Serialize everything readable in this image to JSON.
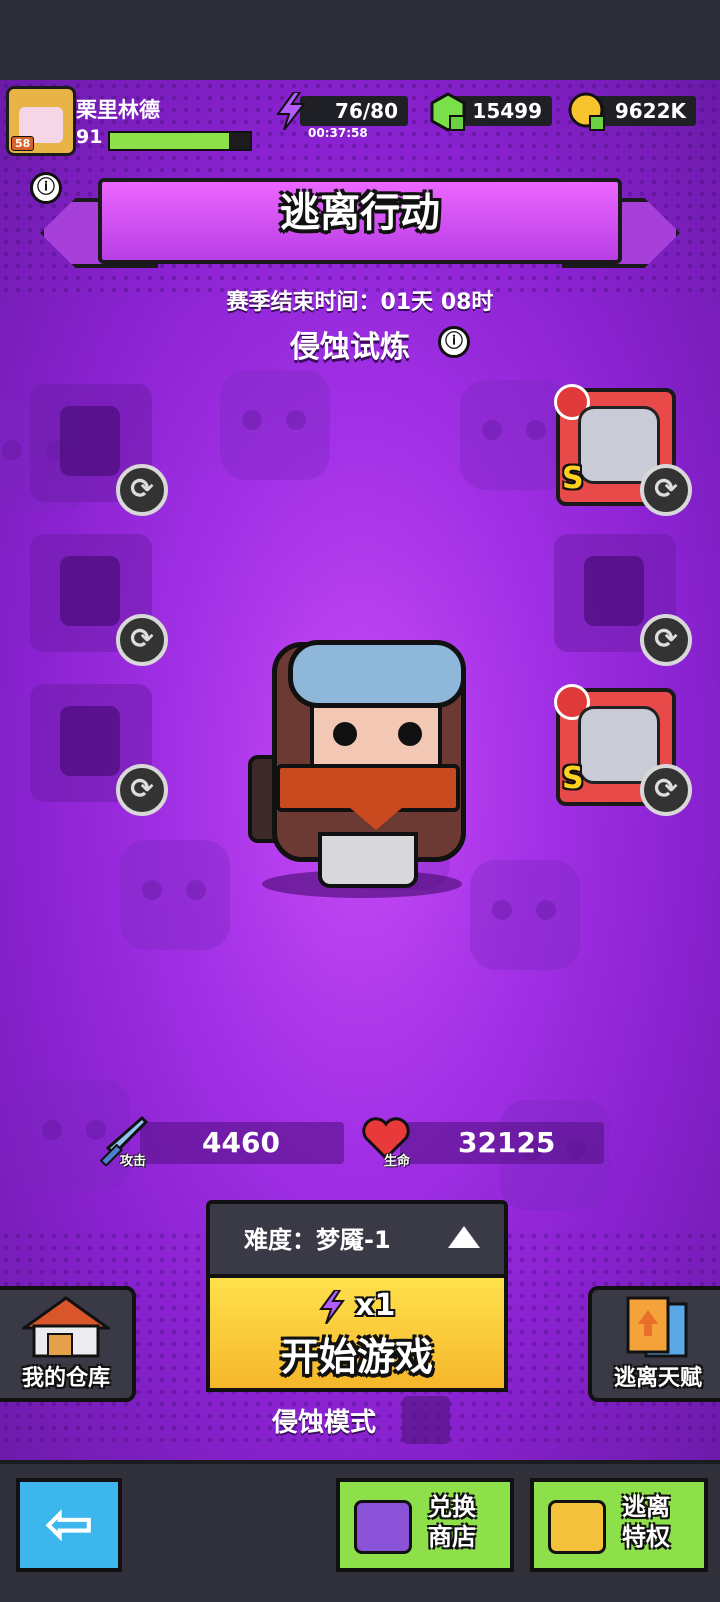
{
  "player": {
    "name": "栗里林德",
    "level": "91",
    "avatar_badge": "58",
    "xp_fraction": 0.85
  },
  "resources": {
    "energy": "76/80",
    "energy_timer": "00:37:58",
    "gems": "15499",
    "gold": "9622K"
  },
  "event": {
    "title": "逃离行动",
    "season_end": "赛季结束时间：01天 08时",
    "mode_title": "侵蚀试炼",
    "info_icon": "ⓘ"
  },
  "equipment": {
    "left_slots": [
      "weapon-slot-empty",
      "necklace-slot-empty",
      "glove-slot-empty"
    ],
    "right_slots": [
      {
        "name": "armor-slot",
        "grade": "S"
      },
      {
        "name": "belt-slot-empty"
      },
      {
        "name": "boots-slot",
        "grade": "S"
      }
    ]
  },
  "stats": {
    "attack_label": "攻击",
    "attack_value": "4460",
    "hp_label": "生命",
    "hp_value": "32125"
  },
  "play": {
    "difficulty": "难度：梦魇-1",
    "energy_cost": "x1",
    "start_label": "开始游戏",
    "mode_label": "侵蚀模式"
  },
  "side": {
    "warehouse": "我的仓库",
    "talent": "逃离天赋"
  },
  "bottom_nav": {
    "shop_line1": "兑换",
    "shop_line2": "商店",
    "privilege_line1": "逃离",
    "privilege_line2": "特权"
  },
  "colors": {
    "banner": "#d94fff",
    "start": "#f5c531",
    "nav_green": "#8ee04a",
    "back_blue": "#3db6ee"
  }
}
